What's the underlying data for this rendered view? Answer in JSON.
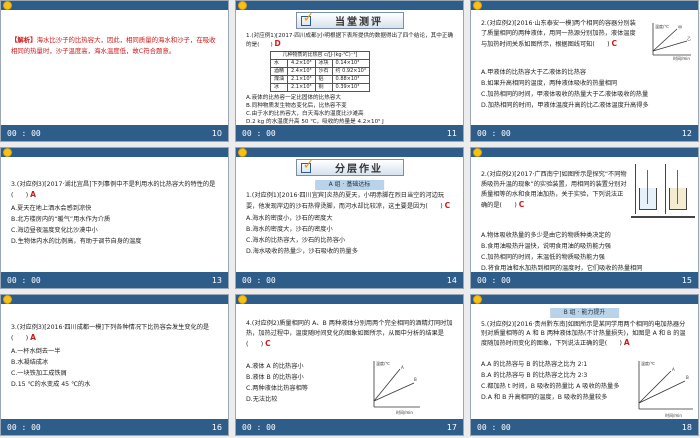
{
  "slides": [
    {
      "page": "10",
      "time": "00 : 00",
      "analysis_label": "【解析】",
      "analysis_text": "海水比沙子的比热容大，因此，相同质量的海水和沙子，在吸收相同的热量时，沙子温度高，海水温度低，故C符合题意。"
    },
    {
      "page": "11",
      "time": "00 : 00",
      "header": "当堂测评",
      "question": "1.(对应例1)[2017·四川成都]小明根据下表所提供的数据得出了四个结论，其中正确的是(　　)",
      "answer": "D",
      "table_caption": "几种物质的比热容 c/[J·(kg·℃)⁻¹]",
      "table_rows": [
        [
          "水",
          "4.2×10³",
          "冰块",
          "0.14×10³"
        ],
        [
          "酒精",
          "2.4×10³",
          "沙石",
          "约 0.92×10³"
        ],
        [
          "煤油",
          "2.1×10³",
          "铝",
          "0.88×10³"
        ],
        [
          "冰",
          "2.1×10³",
          "铜",
          "0.39×10³"
        ]
      ],
      "options": [
        "A.液体的比热容一定比固体的比热容大",
        "B.同种物质发生物态变化后，比热容不变",
        "C.由于水的比热容大，白天海水的温度比沙滩高",
        "D.2 kg 的水温度升高 50 ℃，吸收的热量是 4.2×10⁵ J"
      ]
    },
    {
      "page": "12",
      "time": "00 : 00",
      "question": "2.(对应例2)[2016·山东泰安一模]两个相同的容器分别装了质量相同的两种液体，用同一热源分别加热，液体温度与加热时间关系如图所示，根据图线可知(　　)",
      "answer": "C",
      "options": [
        "A.甲液体的比热容大于乙液体的比热容",
        "B.如果升高相同的温度，两种液体吸收的热量相同",
        "C.加热相同的时间，甲液体吸收的热量大于乙液体吸收的热量",
        "D.加热相同的时间，甲液体温度升高的比乙液体温度升高得多"
      ],
      "graph_labels": [
        "温度/℃",
        "甲",
        "乙",
        "时间/min"
      ]
    },
    {
      "page": "13",
      "time": "00 : 00",
      "question": "3.(对应例3)[2017·湖北宜昌]下列事例中不是利用水的比热容大的特性的是(　　)",
      "answer": "A",
      "options": [
        "A.夏天在地上洒水会感到凉快",
        "B.北方楼房内的“暖气”用水作为介质",
        "C.海边昼夜温度变化比沙漠中小",
        "D.生物体内水的比例高，有助于调节自身的温度"
      ]
    },
    {
      "page": "14",
      "time": "00 : 00",
      "header": "分层作业",
      "tag": "A 组 · 基础达标",
      "question": "1.(对应例1)[2016·四川宜宾]炎热的夏天，小明赤脚在烈日当空的河边玩耍，他发现岸边的沙石热得烫脚，而河水却比较凉，这主要是因为(　　)",
      "answer": "C",
      "options": [
        "A.海水的密度小，沙石的密度大",
        "B.海水的密度大，沙石的密度小",
        "C.海水的比热容大，沙石的比热容小",
        "D.海水吸收的热量少，沙石吸收的热量多"
      ]
    },
    {
      "page": "15",
      "time": "00 : 00",
      "question": "2.(对应例2)[2017·广西南宁]如图所示是探究“不同物质吸热升温的现象”的实验装置，用相同的装置分别对质量相等的水和食用油加热，关于实验，下列说法正确的是(　　)",
      "answer": "C",
      "options": [
        "A.物体吸收热量的多少是由它的物质种类决定的",
        "B.食用油吸热升温快，说明食用油的吸热能力强",
        "C.加热相同的时间，末温低的物质吸热能力强",
        "D.将食用油和水加热到相同的温度时，它们吸收的热量相同"
      ]
    },
    {
      "page": "16",
      "time": "00 : 00",
      "question": "3.(对应例3)[2016·四川成都一模]下列各种情况下比热容会发生变化的是(　　)",
      "answer": "A",
      "options": [
        "A.一杯水倒去一半",
        "B.水凝结成冰",
        "C.一块铁加工成铁屑",
        "D.15 ℃的水变成 45 ℃的水"
      ]
    },
    {
      "page": "17",
      "time": "00 : 00",
      "question": "4.(对应例2)质量相同的 A、B 两种液体分别用两个完全相同的酒精灯同时加热，加热过程中，温度随时间变化的图象如图所示，从图中分析的结果是(　　)",
      "answer": "C",
      "options": [
        "A.液体 A 的比热容小",
        "B.液体 B 的比热容小",
        "C.两种液体比热容相等",
        "D.无法比较"
      ],
      "graph_labels": [
        "温度/℃",
        "A",
        "B",
        "时间/min"
      ]
    },
    {
      "page": "18",
      "time": "00 : 00",
      "tag": "B 组 · 能力提升",
      "question": "5.(对应例2)[2016·贵州黔东南]如图所示是某同学用两个相同的电加热器分别对质量相等的 A 和 B 两种液体加热(不计热量损失)，如图是 A 和 B 的温度随加热时间变化的图象，下列说法正确的是(　　)",
      "answer": "A",
      "options": [
        "A.A 的比热容与 B 的比热容之比为 2∶1",
        "B.A 的比热容与 B 的比热容之比为 2∶3",
        "C.都加热 t 时间，B 吸收的热量比 A 吸收的热量多",
        "D.A 和 B 升高相同的温度，B 吸收的热量较多"
      ],
      "graph_labels": [
        "温度/℃",
        "A",
        "B",
        "时间/min"
      ]
    }
  ]
}
